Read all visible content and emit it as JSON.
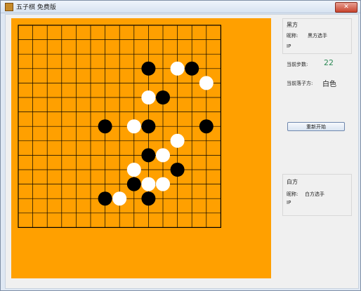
{
  "window": {
    "title": "五子棋 免费版",
    "close_glyph": "✕"
  },
  "board": {
    "size": 15,
    "background": "#FFA000",
    "line_color": "#000000",
    "stones": [
      {
        "col": 9,
        "row": 3,
        "color": "black"
      },
      {
        "col": 11,
        "row": 3,
        "color": "white"
      },
      {
        "col": 12,
        "row": 3,
        "color": "black"
      },
      {
        "col": 13,
        "row": 4,
        "color": "white"
      },
      {
        "col": 9,
        "row": 5,
        "color": "white"
      },
      {
        "col": 10,
        "row": 5,
        "color": "black"
      },
      {
        "col": 6,
        "row": 7,
        "color": "black"
      },
      {
        "col": 8,
        "row": 7,
        "color": "white"
      },
      {
        "col": 9,
        "row": 7,
        "color": "black"
      },
      {
        "col": 13,
        "row": 7,
        "color": "black"
      },
      {
        "col": 11,
        "row": 8,
        "color": "white"
      },
      {
        "col": 9,
        "row": 9,
        "color": "black"
      },
      {
        "col": 10,
        "row": 9,
        "color": "white"
      },
      {
        "col": 8,
        "row": 10,
        "color": "white"
      },
      {
        "col": 11,
        "row": 10,
        "color": "black"
      },
      {
        "col": 8,
        "row": 11,
        "color": "black"
      },
      {
        "col": 9,
        "row": 11,
        "color": "white"
      },
      {
        "col": 10,
        "row": 11,
        "color": "white"
      },
      {
        "col": 6,
        "row": 12,
        "color": "black"
      },
      {
        "col": 7,
        "row": 12,
        "color": "white"
      },
      {
        "col": 9,
        "row": 12,
        "color": "black"
      }
    ]
  },
  "black_player": {
    "title": "黑方",
    "name_label": "昵称:",
    "name": "黑方选手",
    "ip_label": "IP"
  },
  "white_player": {
    "title": "白方",
    "name_label": "昵称:",
    "name": "白方选手",
    "ip_label": "IP"
  },
  "status": {
    "step_label": "当前步数:",
    "step_value": "22",
    "turn_label": "当前落子方:",
    "turn_value": "白色"
  },
  "controls": {
    "restart_label": "重新开始"
  }
}
